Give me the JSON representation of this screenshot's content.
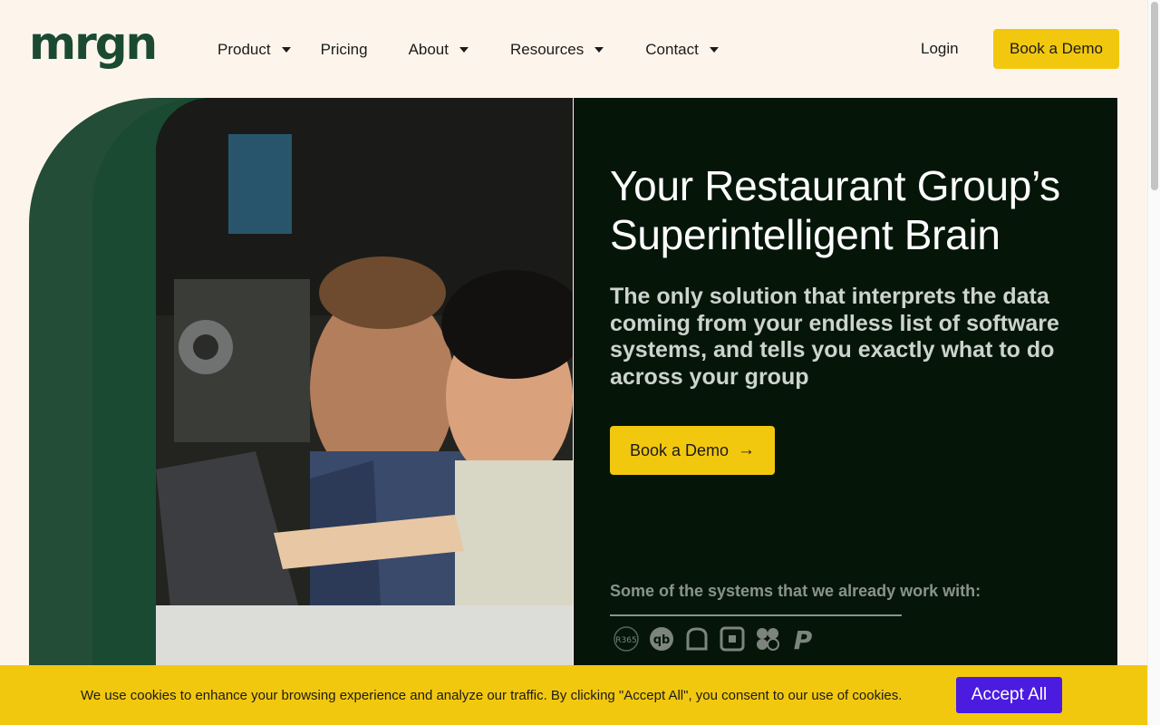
{
  "header": {
    "logo_text": "mrgn",
    "nav": [
      {
        "label": "Product",
        "has_caret": true
      },
      {
        "label": "Pricing",
        "has_caret": false
      },
      {
        "label": "About",
        "has_caret": true
      },
      {
        "label": "Resources",
        "has_caret": true
      },
      {
        "label": "Contact",
        "has_caret": true
      }
    ],
    "login_label": "Login",
    "demo_label": "Book a Demo"
  },
  "hero": {
    "title_line1": "Your Restaurant Group’s",
    "title_line2": "Superintelligent Brain",
    "subtitle": "The only solution that interprets the data coming from your endless list of software systems, and tells you exactly what to do across your group",
    "cta_label": "Book a Demo",
    "cta_icon": "arrow-right-icon",
    "systems_label": "Some of the systems that we already work with:",
    "systems": [
      {
        "icon": "r365-icon",
        "text": "R365"
      },
      {
        "icon": "quickbooks-icon",
        "text": "qb"
      },
      {
        "icon": "toast-icon",
        "text": ""
      },
      {
        "icon": "square-icon",
        "text": ""
      },
      {
        "icon": "clover-icon",
        "text": ""
      },
      {
        "icon": "paypal-icon",
        "text": "P"
      }
    ]
  },
  "cookie": {
    "message": "We use cookies to enhance your browsing experience and analyze our traffic.  By clicking \"Accept All\", you consent to our use of cookies.",
    "accept_label": "Accept All"
  },
  "colors": {
    "background": "#fdf5ec",
    "brand_green": "#1a4a32",
    "hero_panel": "#051609",
    "accent_yellow": "#f2c80f",
    "accept_purple": "#4b1be0"
  }
}
